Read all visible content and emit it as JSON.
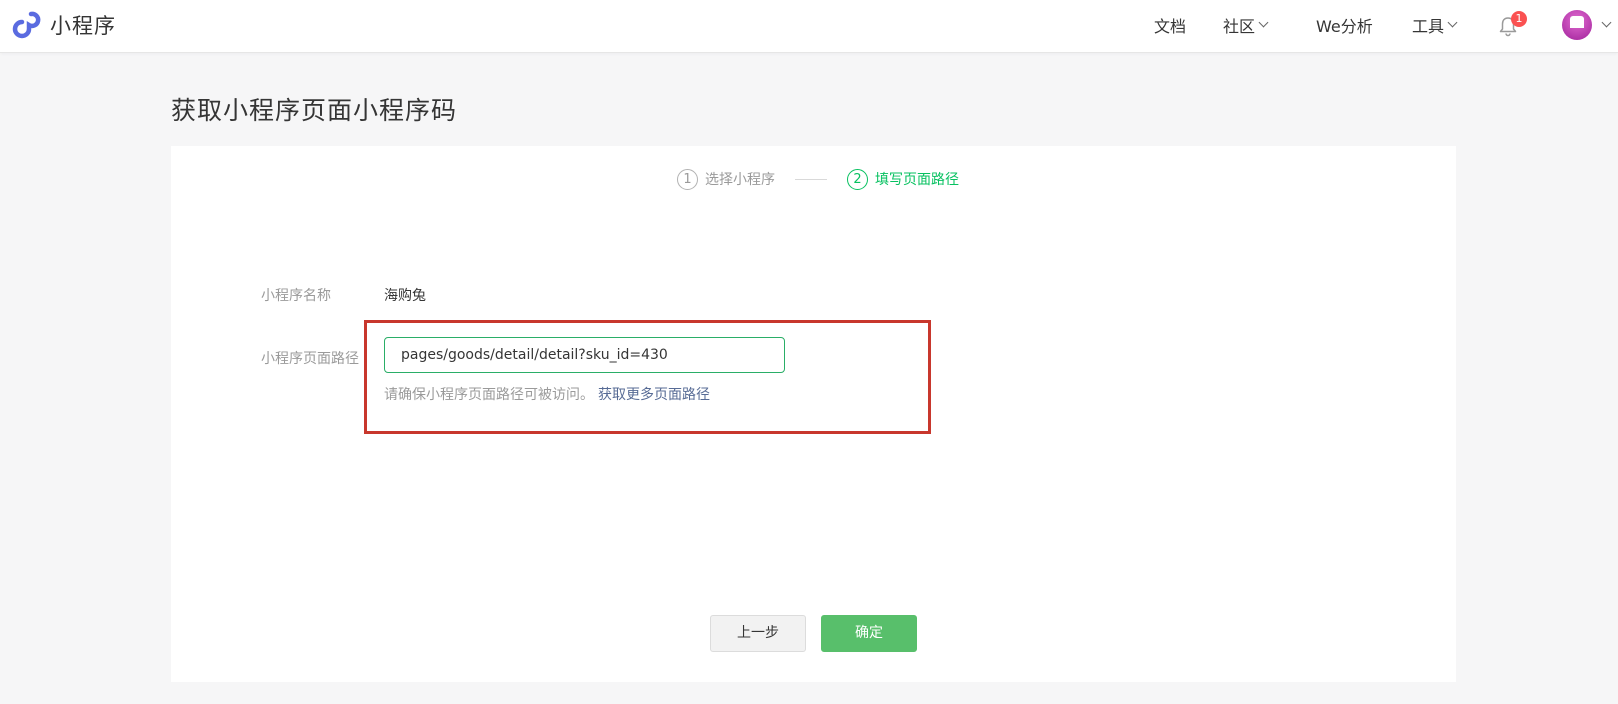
{
  "header": {
    "brand": "小程序",
    "nav": [
      {
        "label": "文档",
        "dropdown": false
      },
      {
        "label": "社区",
        "dropdown": true
      },
      {
        "label": "We分析",
        "dropdown": false
      },
      {
        "label": "工具",
        "dropdown": true
      }
    ],
    "notification_count": "1",
    "colors": {
      "badge": "#fa5151",
      "accent": "#07c160"
    }
  },
  "page": {
    "title": "获取小程序页面小程序码"
  },
  "steps": [
    {
      "num": "1",
      "label": "选择小程序",
      "active": false
    },
    {
      "num": "2",
      "label": "填写页面路径",
      "active": true
    }
  ],
  "form": {
    "name_label": "小程序名称",
    "name_value": "海购兔",
    "path_label": "小程序页面路径",
    "path_value": "pages/goods/detail/detail?sku_id=430",
    "hint": "请确保小程序页面路径可被访问。",
    "hint_link": "获取更多页面路径"
  },
  "actions": {
    "prev": "上一步",
    "confirm": "确定"
  },
  "icons": [
    "miniprogram-logo-icon",
    "chevron-down-icon",
    "bell-icon",
    "avatar"
  ]
}
